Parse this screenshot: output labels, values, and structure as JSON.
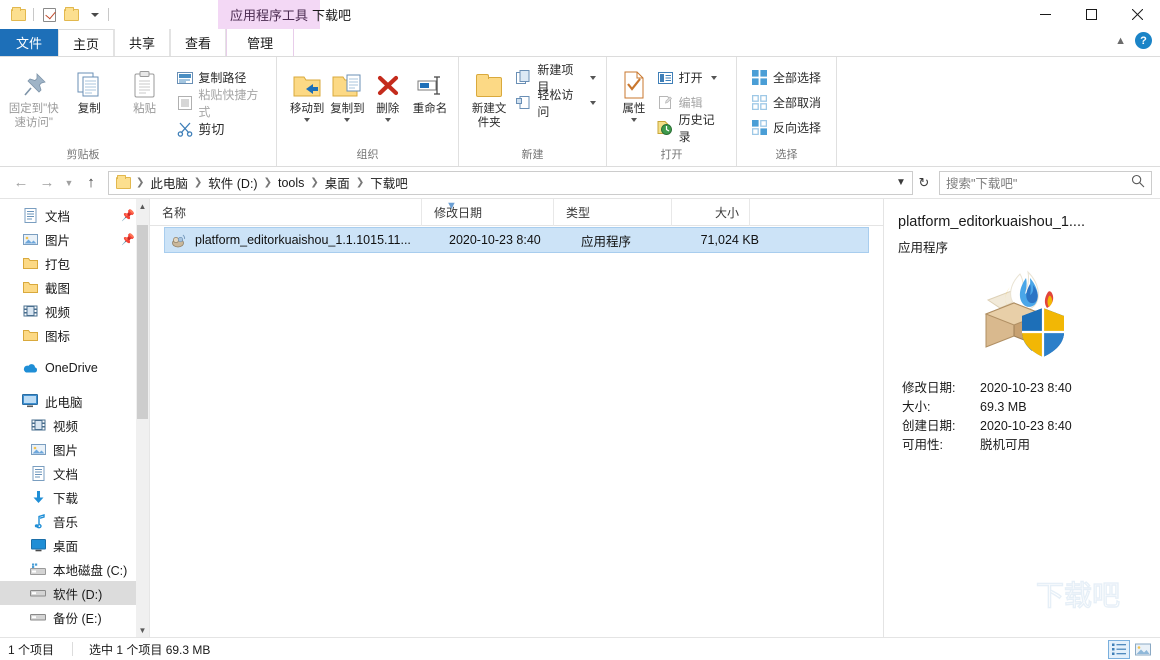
{
  "titlebar": {
    "quick_access": [
      "folder-icon",
      "properties-checkbox-icon",
      "new-folder-icon",
      "customize-caret"
    ],
    "contextual_tab_label": "应用程序工具",
    "window_title": "下载吧",
    "minimize": "minimize-icon",
    "maximize": "maximize-icon",
    "close": "close-icon"
  },
  "tabs": [
    {
      "label": "文件",
      "kind": "file"
    },
    {
      "label": "主页",
      "kind": "active"
    },
    {
      "label": "共享",
      "kind": "normal"
    },
    {
      "label": "查看",
      "kind": "normal"
    },
    {
      "label": "管理",
      "kind": "contextual"
    }
  ],
  "ribbon": {
    "groups": [
      {
        "title": "剪贴板",
        "big": [
          {
            "label": "固定到\"快速访问\"",
            "icon": "pin-icon",
            "dim": true
          },
          {
            "label": "复制",
            "icon": "copy-icon",
            "dim": false
          },
          {
            "label": "粘贴",
            "icon": "paste-icon",
            "dim": true
          }
        ],
        "small": [
          {
            "label": "复制路径",
            "icon": "copy-path-icon",
            "dim": false
          },
          {
            "label": "粘贴快捷方式",
            "icon": "paste-shortcut-icon",
            "dim": true
          },
          {
            "label": "剪切",
            "icon": "scissors-icon",
            "dim": false
          }
        ]
      },
      {
        "title": "组织",
        "big": [
          {
            "label": "移动到",
            "icon": "move-to-icon",
            "caret": true
          },
          {
            "label": "复制到",
            "icon": "copy-to-icon",
            "caret": true
          },
          {
            "label": "删除",
            "icon": "delete-icon",
            "caret": true
          },
          {
            "label": "重命名",
            "icon": "rename-icon",
            "caret": false
          }
        ]
      },
      {
        "title": "新建",
        "big": [
          {
            "label": "新建文件夹",
            "icon": "new-folder-icon"
          }
        ],
        "small": [
          {
            "label": "新建项目",
            "icon": "new-item-icon",
            "caret": true
          },
          {
            "label": "轻松访问",
            "icon": "easy-access-icon",
            "caret": true
          }
        ]
      },
      {
        "title": "打开",
        "big": [
          {
            "label": "属性",
            "icon": "properties-icon",
            "caret": true
          }
        ],
        "small": [
          {
            "label": "打开",
            "icon": "open-icon",
            "caret": true,
            "dim": false
          },
          {
            "label": "编辑",
            "icon": "edit-icon",
            "dim": true
          },
          {
            "label": "历史记录",
            "icon": "history-icon",
            "dim": false
          }
        ]
      },
      {
        "title": "选择",
        "small": [
          {
            "label": "全部选择",
            "icon": "select-all-icon"
          },
          {
            "label": "全部取消",
            "icon": "select-none-icon"
          },
          {
            "label": "反向选择",
            "icon": "invert-selection-icon"
          }
        ]
      }
    ]
  },
  "addressbar": {
    "back": "back-arrow-icon",
    "forward": "forward-arrow-icon",
    "recent": "recent-locations-icon",
    "up": "up-arrow-icon",
    "breadcrumbs": [
      "此电脑",
      "软件 (D:)",
      "tools",
      "桌面",
      "下载吧"
    ],
    "dropdown": "address-dropdown-icon",
    "refresh": "refresh-icon",
    "search_placeholder": "搜索\"下载吧\"",
    "search_value": "",
    "search_icon": "search-icon"
  },
  "sidebar": {
    "groups": [
      {
        "items": [
          {
            "label": "文档",
            "icon": "documents-icon",
            "pinned": true
          },
          {
            "label": "图片",
            "icon": "pictures-icon",
            "pinned": true
          },
          {
            "label": "打包",
            "icon": "folder-icon",
            "pinned": false
          },
          {
            "label": "截图",
            "icon": "folder-icon",
            "pinned": false
          },
          {
            "label": "视频",
            "icon": "videos-icon",
            "pinned": false
          },
          {
            "label": "图标",
            "icon": "folder-icon",
            "pinned": false
          }
        ]
      },
      {
        "items": [
          {
            "label": "OneDrive",
            "icon": "onedrive-icon",
            "pinned": false
          }
        ]
      },
      {
        "items": [
          {
            "label": "此电脑",
            "icon": "this-pc-icon",
            "root": true
          },
          {
            "label": "视频",
            "icon": "videos-icon",
            "indent": true
          },
          {
            "label": "图片",
            "icon": "pictures-icon",
            "indent": true
          },
          {
            "label": "文档",
            "icon": "documents-icon",
            "indent": true
          },
          {
            "label": "下载",
            "icon": "downloads-icon",
            "indent": true
          },
          {
            "label": "音乐",
            "icon": "music-icon",
            "indent": true
          },
          {
            "label": "桌面",
            "icon": "desktop-icon",
            "indent": true
          },
          {
            "label": "本地磁盘 (C:)",
            "icon": "system-drive-icon",
            "indent": true
          },
          {
            "label": "软件 (D:)",
            "icon": "drive-icon",
            "indent": true,
            "selected": true
          },
          {
            "label": "备份 (E:)",
            "icon": "drive-icon",
            "indent": true
          }
        ]
      }
    ],
    "scroll_up": "scroll-up-arrow",
    "scroll_down": "scroll-down-arrow"
  },
  "filelist": {
    "columns": [
      "名称",
      "修改日期",
      "类型",
      "大小"
    ],
    "sort_indicator": "sort-ascending-icon",
    "rows": [
      {
        "name": "platform_editorkuaishou_1.1.1015.11...",
        "date": "2020-10-23 8:40",
        "type": "应用程序",
        "size": "71,024 KB",
        "icon": "application-icon",
        "selected": true
      }
    ]
  },
  "details": {
    "title": "platform_editorkuaishou_1....",
    "subtitle": "应用程序",
    "preview_icon": "kuaishou-editor-app-icon",
    "properties": [
      {
        "label": "修改日期:",
        "value": "2020-10-23 8:40"
      },
      {
        "label": "大小:",
        "value": "69.3 MB"
      },
      {
        "label": "创建日期:",
        "value": "2020-10-23 8:40"
      },
      {
        "label": "可用性:",
        "value": "脱机可用"
      }
    ],
    "watermark": "下载吧"
  },
  "statusbar": {
    "item_count": "1 个项目",
    "selection": "选中 1 个项目  69.3 MB",
    "view_details": "details-view-icon",
    "view_large": "large-icons-view-icon"
  },
  "colors": {
    "accent": "#1d6fb8",
    "contextual_tab_bg": "#f3d8f5",
    "selection_bg": "#cce3f7",
    "selection_border": "#a8cdee",
    "sidebar_selection": "#dcdcdc"
  }
}
